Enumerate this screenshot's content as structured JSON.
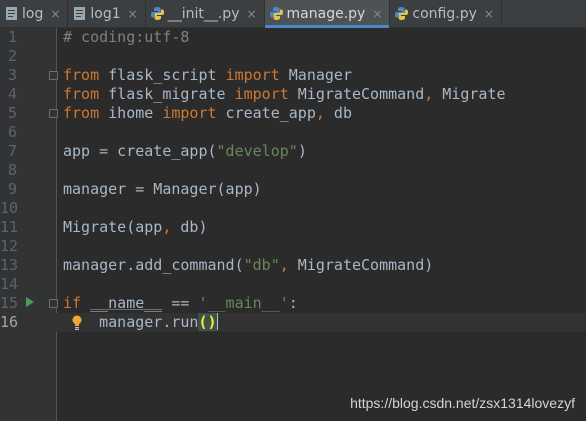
{
  "tabs": [
    {
      "label": "log",
      "icon": "text-file-icon",
      "active": false
    },
    {
      "label": "log1",
      "icon": "text-file-icon",
      "active": false
    },
    {
      "label": "__init__.py",
      "icon": "python-file-icon",
      "active": false
    },
    {
      "label": "manage.py",
      "icon": "python-file-icon",
      "active": true
    },
    {
      "label": "config.py",
      "icon": "python-file-icon",
      "active": false
    }
  ],
  "close_glyph": "×",
  "editor": {
    "line_numbers": [
      "1",
      "2",
      "3",
      "4",
      "5",
      "6",
      "7",
      "8",
      "9",
      "10",
      "11",
      "12",
      "13",
      "14",
      "15",
      "16"
    ],
    "lines": {
      "l1": {
        "comment": "# coding:utf-8"
      },
      "l3": {
        "kw1": "from",
        "mod": " flask_script ",
        "kw2": "import",
        "name": " Manager"
      },
      "l4": {
        "kw1": "from",
        "mod": " flask_migrate ",
        "kw2": "import",
        "name1": " MigrateCommand",
        "comma": ",",
        "name2": " Migrate"
      },
      "l5": {
        "kw1": "from",
        "mod": " ihome ",
        "kw2": "import",
        "name1": " create_app",
        "comma": ",",
        "name2": " db"
      },
      "l7": {
        "pre": "app = create_app(",
        "str": "\"develop\"",
        "post": ")"
      },
      "l9": {
        "text": "manager = Manager(app)"
      },
      "l11": {
        "pre": "Migrate(app",
        "comma": ",",
        "post": " db)"
      },
      "l13": {
        "pre": "manager.add_command(",
        "str": "\"db\"",
        "comma": ",",
        "post": " MigrateCommand)"
      },
      "l15": {
        "kw": "if",
        "sp1": " ",
        "dunder": "__name__",
        "op": " == ",
        "str": "'__main__'",
        "colon": ":"
      },
      "l16": {
        "indent": "    ",
        "pre": "manager.run",
        "paren": "()"
      }
    }
  },
  "watermark": "https://blog.csdn.net/zsx1314lovezyf",
  "colors": {
    "background": "#2b2b2b",
    "keyword": "#cc7832",
    "string": "#6a8759",
    "comment": "#808080",
    "text": "#a9b7c6",
    "tab_accent": "#4a88c7"
  }
}
